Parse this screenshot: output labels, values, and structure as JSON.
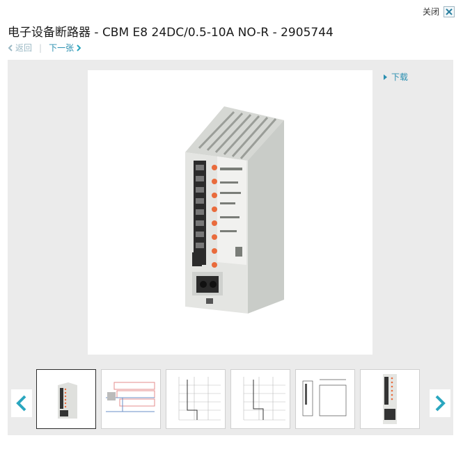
{
  "window": {
    "close_label": "关闭",
    "close_icon": "close-x-icon"
  },
  "product": {
    "title": "电子设备断路器 - CBM E8 24DC/0.5-10A NO-R - 2905744"
  },
  "nav": {
    "back_label": "返回",
    "next_label": "下一张"
  },
  "viewer": {
    "download_label": "下载",
    "thumbnails": [
      {
        "kind": "product-photo",
        "selected": true
      },
      {
        "kind": "circuit-diagram",
        "selected": false
      },
      {
        "kind": "characteristic-curve",
        "selected": false
      },
      {
        "kind": "characteristic-curve",
        "selected": false
      },
      {
        "kind": "dimension-drawing",
        "selected": false
      },
      {
        "kind": "front-view",
        "selected": false
      }
    ]
  },
  "colors": {
    "accent": "#2a8fb0",
    "arrow": "#2aa6bf",
    "panel_bg": "#ebebeb"
  }
}
